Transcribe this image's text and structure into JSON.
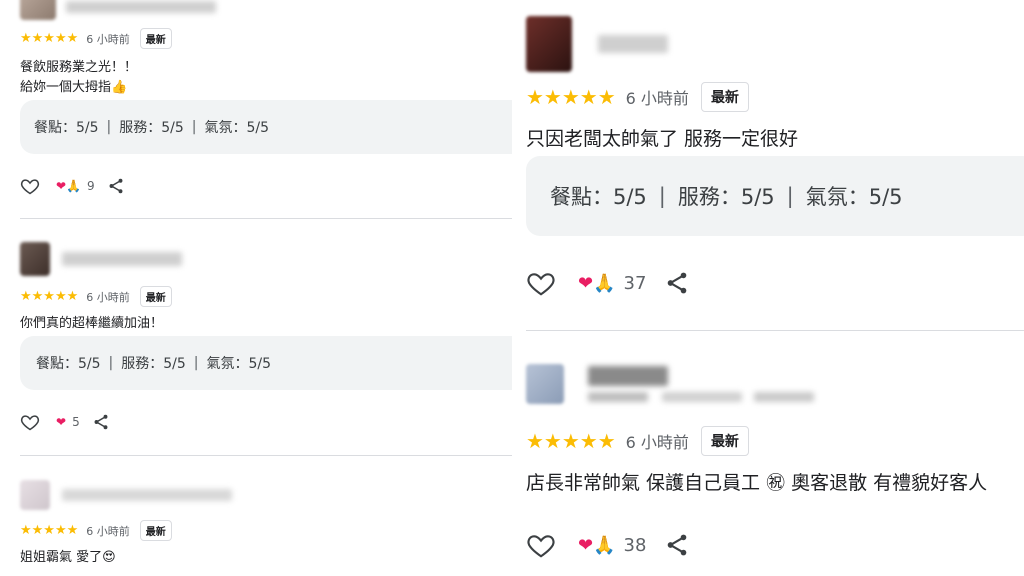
{
  "reviews_left": [
    {
      "stars": "★★★★★",
      "time": "6 小時前",
      "badge": "最新",
      "lines": [
        "餐飲服務業之光！！",
        "給妳一個大拇指👍"
      ],
      "ratings": {
        "food": "餐點：5/5",
        "service": "服務：5/5",
        "atmosphere": "氣氛：5/5",
        "sep": "|"
      },
      "reaction_emoji": "❤🙏",
      "count": "9",
      "name_blurred": true
    },
    {
      "stars": "★★★★★",
      "time": "6 小時前",
      "badge": "最新",
      "lines": [
        "你們真的超棒繼續加油！"
      ],
      "ratings": {
        "food": "餐點：5/5",
        "service": "服務：5/5",
        "atmosphere": "氣氛：5/5",
        "sep": "|"
      },
      "reaction_emoji": "❤",
      "count": "5",
      "name_blurred": true
    },
    {
      "stars": "★★★★★",
      "time": "6 小時前",
      "badge": "最新",
      "lines": [
        "姐姐霸氣 愛了😍"
      ],
      "name_blurred": true
    }
  ],
  "reviews_right": [
    {
      "stars": "★★★★★",
      "time": "6 小時前",
      "badge": "最新",
      "lines": [
        "只因老闆太帥氣了 服務一定很好"
      ],
      "ratings": {
        "food": "餐點：5/5",
        "service": "服務：5/5",
        "atmosphere": "氣氛：5/5",
        "sep": "|"
      },
      "reaction_emoji": "❤🙏",
      "count": "37",
      "name_blurred": true
    },
    {
      "stars": "★★★★★",
      "time": "6 小時前",
      "badge": "最新",
      "lines": [
        "店長非常帥氣 保護自己員工 ㊗ 奧客退散 有禮貌好客人"
      ],
      "reaction_emoji": "❤🙏",
      "count": "38",
      "name_blurred": true
    }
  ],
  "colors": {
    "star": "#fbbc04",
    "heart": "#e91e63",
    "ratings_bg": "#f1f3f4",
    "divider": "#dadce0"
  },
  "icons": {
    "like": "heart-outline-icon",
    "share": "share-icon",
    "reaction_heart": "heart-emoji-icon",
    "reaction_pray": "pray-emoji-icon"
  }
}
